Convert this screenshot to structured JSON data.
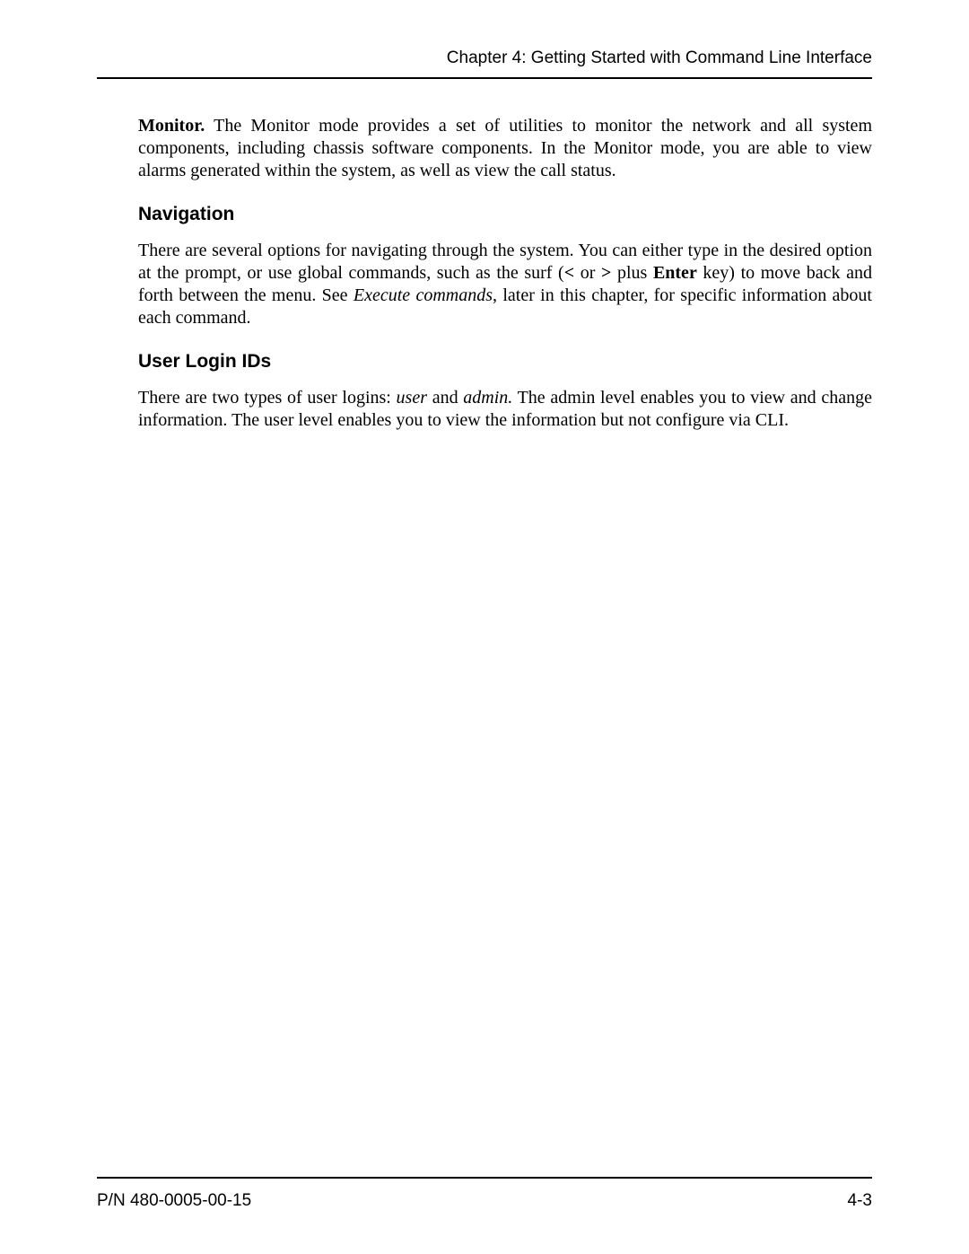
{
  "header": {
    "chapter_title": "Chapter 4: Getting Started with Command Line Interface"
  },
  "content": {
    "monitor": {
      "lead": "Monitor.",
      "text": " The Monitor mode provides a set of utilities to monitor the network and all system components, including chassis software components. In the Monitor mode, you are able to view alarms generated within the system, as well as view the call status."
    },
    "navigation": {
      "heading": "Navigation",
      "text_part1": "There are several options for navigating through the system. You can either type in the desired option at the prompt, or use global commands, such as the surf (",
      "lt": "<",
      "or": " or ",
      "gt": ">",
      "plus": " plus ",
      "enter": "Enter",
      "text_part2": " key) to move back and forth between the menu. See ",
      "exec_cmds": "Execute commands",
      "text_part3": ", later in this chapter, for specific information about each command."
    },
    "user_login": {
      "heading": "User Login IDs",
      "text_part1": "There are two types of user logins: ",
      "user": "user",
      "and": " and ",
      "admin": "admin.",
      "text_part2": " The admin level enables you to view and change information. The user level enables you to view the information but not configure via CLI."
    }
  },
  "footer": {
    "part_number": "P/N 480-0005-00-15",
    "page_number": "4-3"
  }
}
